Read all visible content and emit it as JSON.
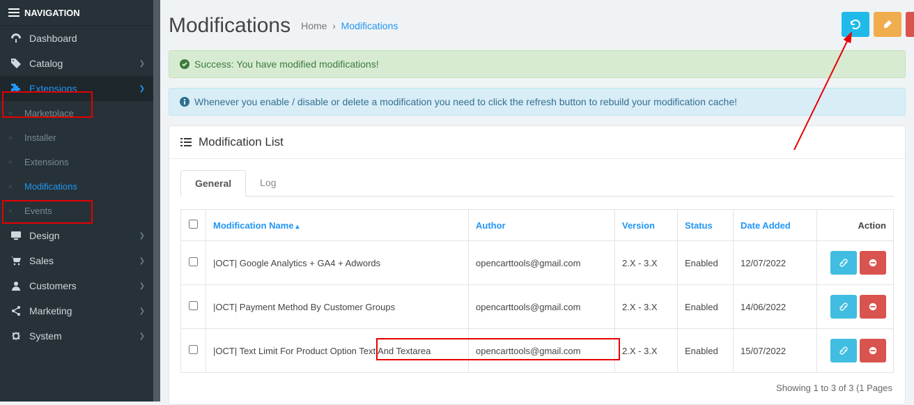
{
  "nav": {
    "header": "NAVIGATION",
    "items": [
      {
        "label": "Dashboard"
      },
      {
        "label": "Catalog"
      },
      {
        "label": "Extensions"
      },
      {
        "label": "Design"
      },
      {
        "label": "Sales"
      },
      {
        "label": "Customers"
      },
      {
        "label": "Marketing"
      },
      {
        "label": "System"
      }
    ],
    "ext_sub": [
      {
        "label": "Marketplace"
      },
      {
        "label": "Installer"
      },
      {
        "label": "Extensions"
      },
      {
        "label": "Modifications"
      },
      {
        "label": "Events"
      }
    ]
  },
  "page": {
    "title": "Modifications",
    "crumb_home": "Home",
    "crumb_sep": "›",
    "crumb_current": "Modifications"
  },
  "alerts": {
    "success": "Success: You have modified modifications!",
    "info": "Whenever you enable / disable or delete a modification you need to click the refresh button to rebuild your modification cache!"
  },
  "panel": {
    "heading": "Modification List",
    "tabs": {
      "general": "General",
      "log": "Log"
    }
  },
  "table": {
    "headers": {
      "name": "Modification Name",
      "author": "Author",
      "version": "Version",
      "status": "Status",
      "date": "Date Added",
      "action": "Action"
    },
    "rows": [
      {
        "name": "|OCT| Google Analytics + GA4 + Adwords",
        "author": "opencarttools@gmail.com",
        "version": "2.X - 3.X",
        "status": "Enabled",
        "date": "12/07/2022"
      },
      {
        "name": "|OCT| Payment Method By Customer Groups",
        "author": "opencarttools@gmail.com",
        "version": "2.X - 3.X",
        "status": "Enabled",
        "date": "14/06/2022"
      },
      {
        "name": "|OCT| Text Limit For Product Option Text And Textarea",
        "author": "opencarttools@gmail.com",
        "version": "2.X - 3.X",
        "status": "Enabled",
        "date": "15/07/2022"
      }
    ]
  },
  "pager": "Showing 1 to 3 of 3 (1 Pages"
}
